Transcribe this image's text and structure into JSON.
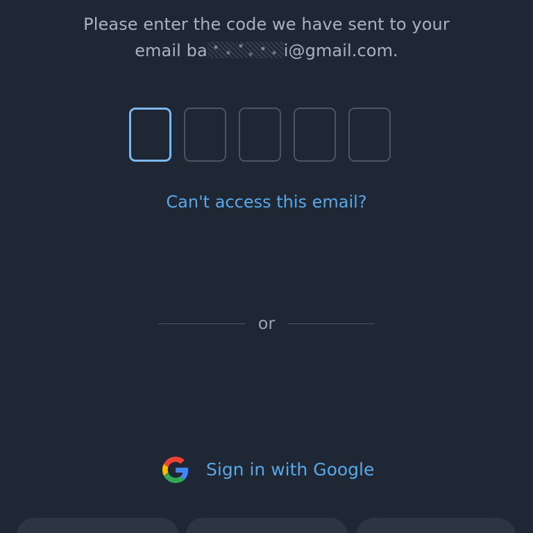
{
  "instruction": {
    "line1": "Please enter the code we have sent to your",
    "line2_prefix": "email ba",
    "line2_suffix": "i@gmail.com."
  },
  "code_inputs": {
    "count": 5,
    "values": [
      "",
      "",
      "",
      "",
      ""
    ],
    "active_index": 0
  },
  "links": {
    "cant_access": "Can't access this email?"
  },
  "divider": {
    "label": "or"
  },
  "google_signin": {
    "label": "Sign in with Google",
    "icon": "google-logo-icon"
  },
  "colors": {
    "background": "#1e2733",
    "accent": "#58a8e8",
    "active_border": "#7eb8ec",
    "muted_text": "#a9b3bf"
  }
}
